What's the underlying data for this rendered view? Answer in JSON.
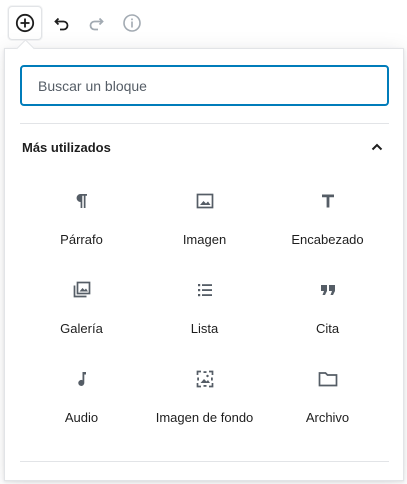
{
  "toolbar": {
    "buttons": [
      {
        "icon": "plus-circle-icon"
      },
      {
        "icon": "undo-icon"
      },
      {
        "icon": "redo-icon"
      },
      {
        "icon": "info-icon"
      }
    ]
  },
  "inserter": {
    "search": {
      "placeholder": "Buscar un bloque",
      "value": ""
    },
    "section": {
      "title": "Más utilizados",
      "toggle_icon": "chevron-up-icon",
      "expanded": true
    },
    "blocks": [
      {
        "label": "Párrafo",
        "icon": "paragraph-icon"
      },
      {
        "label": "Imagen",
        "icon": "image-icon"
      },
      {
        "label": "Encabezado",
        "icon": "heading-icon"
      },
      {
        "label": "Galería",
        "icon": "gallery-icon"
      },
      {
        "label": "Lista",
        "icon": "list-icon"
      },
      {
        "label": "Cita",
        "icon": "quote-icon"
      },
      {
        "label": "Audio",
        "icon": "audio-icon"
      },
      {
        "label": "Imagen de fondo",
        "icon": "cover-image-icon"
      },
      {
        "label": "Archivo",
        "icon": "file-icon"
      }
    ]
  },
  "colors": {
    "accent": "#007cba",
    "text": "#1e1e1e",
    "muted": "#555d66",
    "border": "#e2e4e7",
    "disabled": "#a2aab2"
  }
}
